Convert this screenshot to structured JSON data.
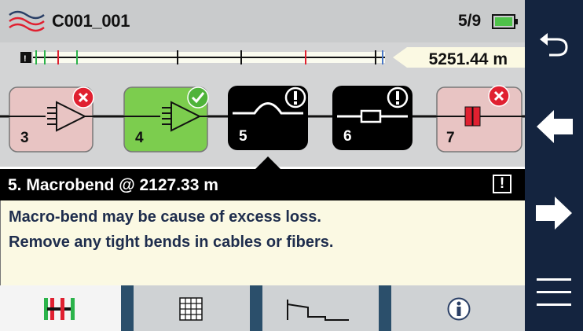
{
  "header": {
    "title": "C001_001",
    "page_indicator": "5/9",
    "icons": [
      "fiber-logo-icon",
      "battery-icon"
    ]
  },
  "scale": {
    "distance": "5251.44 m"
  },
  "events": [
    {
      "number": "3",
      "type": "amplifier",
      "status": "fail"
    },
    {
      "number": "4",
      "type": "amplifier",
      "status": "pass"
    },
    {
      "number": "5",
      "type": "macrobend",
      "status": "warning",
      "selected": true
    },
    {
      "number": "6",
      "type": "connector",
      "status": "warning"
    },
    {
      "number": "7",
      "type": "reflective",
      "status": "fail"
    }
  ],
  "detail": {
    "heading": "5. Macrobend @ 2127.33 m",
    "warning_symbol": "!",
    "line1": "Macro-bend may be cause of excess loss.",
    "line2": "Remove any tight bends in cables or fibers."
  },
  "tabs": [
    {
      "name": "linkmap-tab",
      "icon": "linkmap-icon",
      "active": true
    },
    {
      "name": "table-tab",
      "icon": "grid-icon",
      "active": false
    },
    {
      "name": "trace-tab",
      "icon": "trace-icon",
      "active": false
    },
    {
      "name": "info-tab",
      "icon": "info-icon",
      "active": false
    }
  ],
  "sidebar": [
    "back-icon",
    "previous-arrow-icon",
    "next-arrow-icon",
    "menu-icon"
  ],
  "colors": {
    "sidebar_bg": "#14243f",
    "pass_green": "#7ccd4e",
    "fail_pink": "#e8c4c3",
    "fail_red": "#e02030",
    "tab_bar": "#2b4f6b"
  }
}
